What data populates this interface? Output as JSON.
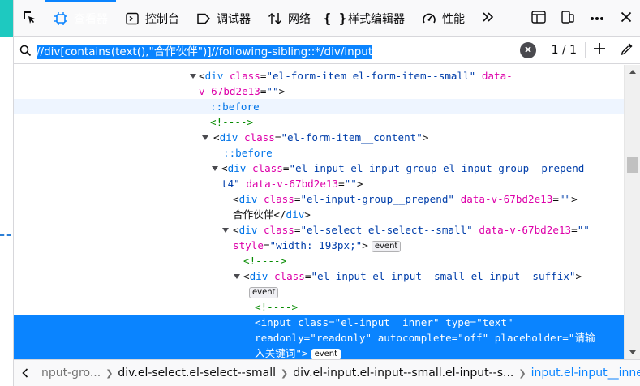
{
  "toolbar": {
    "tabs": [
      {
        "label": "查看器",
        "icon": "inspector-icon"
      },
      {
        "label": "控制台",
        "icon": "console-icon"
      },
      {
        "label": "调试器",
        "icon": "debugger-icon"
      },
      {
        "label": "网络",
        "icon": "network-icon"
      },
      {
        "label": "样式编辑器",
        "icon": "style-editor-icon"
      },
      {
        "label": "性能",
        "icon": "performance-icon"
      }
    ],
    "selected_tab": "查看器",
    "accent_color": "#0a84ff"
  },
  "search": {
    "query": "//div[contains(text(),\"合作伙伴\")]//following-sibling::*/div/input",
    "result_count": "1 / 1"
  },
  "tree": {
    "lines": [
      {
        "parts": [
          {
            "c": "tag",
            "t": "<"
          },
          {
            "c": "tname",
            "t": "div"
          },
          {
            "c": "t",
            "t": " "
          },
          {
            "c": "aname",
            "t": "class"
          },
          {
            "c": "tag",
            "t": "="
          },
          {
            "c": "aval",
            "t": "\"el-form-item el-form-item--small\""
          },
          {
            "c": "t",
            "t": " "
          },
          {
            "c": "aname",
            "t": "data-"
          }
        ]
      },
      {
        "parts": [
          {
            "c": "aname",
            "t": "v-67bd2e13"
          },
          {
            "c": "tag",
            "t": "="
          },
          {
            "c": "aval",
            "t": "\"\""
          },
          {
            "c": "tag",
            "t": ">"
          }
        ]
      },
      {
        "parts": [
          {
            "c": "tname",
            "t": "::before"
          }
        ]
      },
      {
        "parts": [
          {
            "c": "comment",
            "t": "<!---->"
          }
        ]
      },
      {
        "parts": [
          {
            "c": "tag",
            "t": "<"
          },
          {
            "c": "tname",
            "t": "div"
          },
          {
            "c": "t",
            "t": " "
          },
          {
            "c": "aname",
            "t": "class"
          },
          {
            "c": "tag",
            "t": "="
          },
          {
            "c": "aval",
            "t": "\"el-form-item__content\""
          },
          {
            "c": "tag",
            "t": ">"
          }
        ]
      },
      {
        "parts": [
          {
            "c": "tname",
            "t": "::before"
          }
        ]
      },
      {
        "parts": [
          {
            "c": "tag",
            "t": "<"
          },
          {
            "c": "tname",
            "t": "div"
          },
          {
            "c": "t",
            "t": " "
          },
          {
            "c": "aname",
            "t": "class"
          },
          {
            "c": "tag",
            "t": "="
          },
          {
            "c": "aval",
            "t": "\"el-input el-input-group el-input-group--prepend"
          }
        ]
      },
      {
        "parts": [
          {
            "c": "aval",
            "t": "t4\""
          },
          {
            "c": "t",
            "t": " "
          },
          {
            "c": "aname",
            "t": "data-v-67bd2e13"
          },
          {
            "c": "tag",
            "t": "="
          },
          {
            "c": "aval",
            "t": "\"\""
          },
          {
            "c": "tag",
            "t": ">"
          }
        ]
      },
      {
        "parts": [
          {
            "c": "tag",
            "t": "<"
          },
          {
            "c": "tname",
            "t": "div"
          },
          {
            "c": "t",
            "t": " "
          },
          {
            "c": "aname",
            "t": "class"
          },
          {
            "c": "tag",
            "t": "="
          },
          {
            "c": "aval",
            "t": "\"el-input-group__prepend\""
          },
          {
            "c": "t",
            "t": " "
          },
          {
            "c": "aname",
            "t": "data-v-67bd2e13"
          },
          {
            "c": "tag",
            "t": "="
          },
          {
            "c": "aval",
            "t": "\"\""
          },
          {
            "c": "tag",
            "t": ">"
          }
        ]
      },
      {
        "parts": [
          {
            "c": "text",
            "t": "合作伙伴"
          },
          {
            "c": "tag",
            "t": "</"
          },
          {
            "c": "tname",
            "t": "div"
          },
          {
            "c": "tag",
            "t": ">"
          }
        ]
      },
      {
        "parts": [
          {
            "c": "tag",
            "t": "<"
          },
          {
            "c": "tname",
            "t": "div"
          },
          {
            "c": "t",
            "t": " "
          },
          {
            "c": "aname",
            "t": "class"
          },
          {
            "c": "tag",
            "t": "="
          },
          {
            "c": "aval",
            "t": "\"el-select el-select--small\""
          },
          {
            "c": "t",
            "t": " "
          },
          {
            "c": "aname",
            "t": "data-v-67bd2e13"
          },
          {
            "c": "tag",
            "t": "="
          },
          {
            "c": "aval",
            "t": "\"\""
          }
        ]
      },
      {
        "parts": [
          {
            "c": "aname",
            "t": "style"
          },
          {
            "c": "tag",
            "t": "="
          },
          {
            "c": "aval",
            "t": "\"width: 193px;\""
          },
          {
            "c": "tag",
            "t": ">"
          }
        ],
        "badge": "event"
      },
      {
        "parts": [
          {
            "c": "comment",
            "t": "<!---->"
          }
        ]
      },
      {
        "parts": [
          {
            "c": "tag",
            "t": "<"
          },
          {
            "c": "tname",
            "t": "div"
          },
          {
            "c": "t",
            "t": " "
          },
          {
            "c": "aname",
            "t": "class"
          },
          {
            "c": "tag",
            "t": "="
          },
          {
            "c": "aval",
            "t": "\"el-input el-input--small el-input--suffix\""
          },
          {
            "c": "tag",
            "t": ">"
          }
        ]
      },
      {
        "parts": [],
        "badge": "event"
      },
      {
        "parts": [
          {
            "c": "comment",
            "t": "<!---->"
          }
        ]
      },
      {
        "parts": [
          {
            "c": "tag",
            "t": "<"
          },
          {
            "c": "tname",
            "t": "input"
          },
          {
            "c": "t",
            "t": " "
          },
          {
            "c": "aname",
            "t": "class"
          },
          {
            "c": "tag",
            "t": "="
          },
          {
            "c": "aval",
            "t": "\"el-input__inner\""
          },
          {
            "c": "t",
            "t": " "
          },
          {
            "c": "aname",
            "t": "type"
          },
          {
            "c": "tag",
            "t": "="
          },
          {
            "c": "aval",
            "t": "\"text\""
          }
        ]
      },
      {
        "parts": [
          {
            "c": "aname",
            "t": "readonly"
          },
          {
            "c": "tag",
            "t": "="
          },
          {
            "c": "aval",
            "t": "\"readonly\""
          },
          {
            "c": "t",
            "t": " "
          },
          {
            "c": "aname",
            "t": "autocomplete"
          },
          {
            "c": "tag",
            "t": "="
          },
          {
            "c": "aval",
            "t": "\"off\""
          },
          {
            "c": "t",
            "t": " "
          },
          {
            "c": "aname",
            "t": "placeholder"
          },
          {
            "c": "tag",
            "t": "="
          },
          {
            "c": "aval",
            "t": "\"请输"
          }
        ]
      },
      {
        "parts": [
          {
            "c": "aval",
            "t": "入关键词\""
          },
          {
            "c": "tag",
            "t": ">"
          }
        ],
        "badge": "event"
      }
    ]
  },
  "breadcrumbs": [
    "nput-gro...",
    "div.el-select.el-select--small",
    "div.el-input.el-input--small.el-input--s...",
    "input.el-input__inner"
  ]
}
